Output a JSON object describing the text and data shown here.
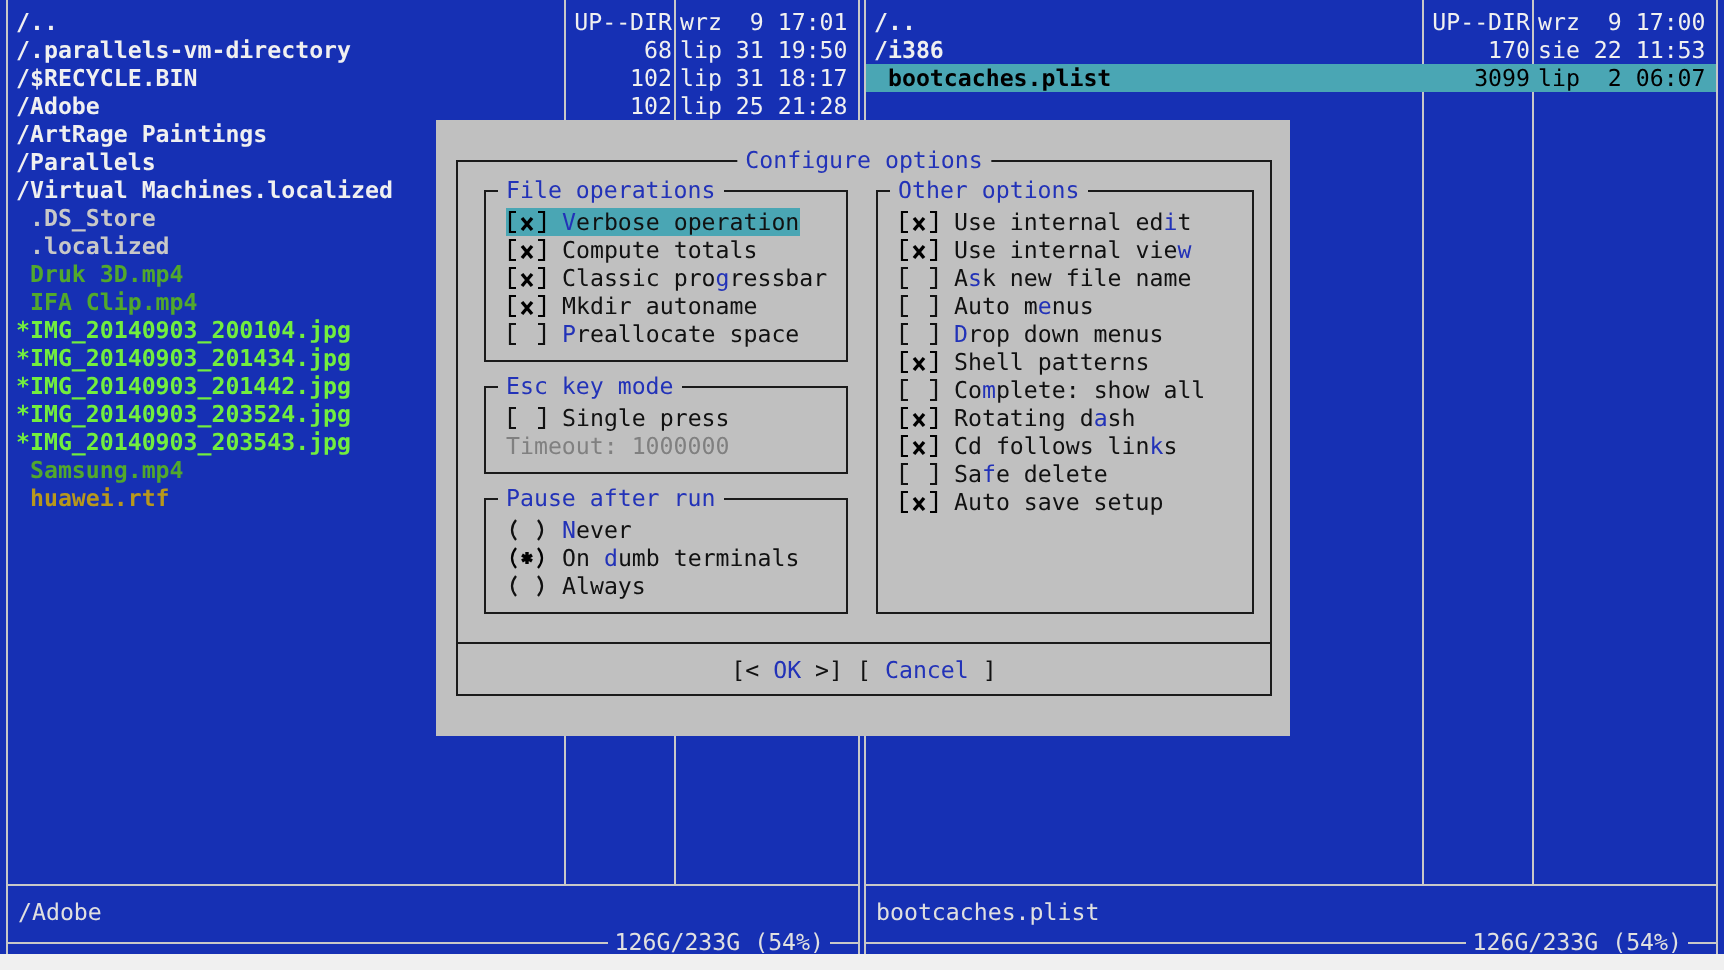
{
  "panels": [
    {
      "rows": [
        {
          "name": "/..",
          "size": "UP--DIR",
          "time": "wrz  9 17:01",
          "color": "#f0f0f0",
          "selected": false
        },
        {
          "name": "/.parallels-vm-directory",
          "size": "68",
          "time": "lip 31 19:50",
          "color": "#f0f0f0",
          "selected": false
        },
        {
          "name": "/$RECYCLE.BIN",
          "size": "102",
          "time": "lip 31 18:17",
          "color": "#f0f0f0",
          "selected": false
        },
        {
          "name": "/Adobe",
          "size": "102",
          "time": "lip 25 21:28",
          "color": "#f0f0f0",
          "selected": false
        },
        {
          "name": "/ArtRage Paintings",
          "color": "#f0f0f0",
          "selected": false
        },
        {
          "name": "/Parallels",
          "color": "#f0f0f0",
          "selected": false
        },
        {
          "name": "/Virtual Machines.localized",
          "color": "#f0f0f0",
          "selected": false
        },
        {
          "name": " .DS_Store",
          "color": "#c8c8c8",
          "selected": false
        },
        {
          "name": " .localized",
          "color": "#c8c8c8",
          "selected": false
        },
        {
          "name": " Druk 3D.mp4",
          "color": "#52a82c",
          "selected": false
        },
        {
          "name": " IFA Clip.mp4",
          "color": "#52a82c",
          "selected": false
        },
        {
          "name": "*IMG_20140903_200104.jpg",
          "color": "#72ee3e",
          "selected": false
        },
        {
          "name": "*IMG_20140903_201434.jpg",
          "color": "#72ee3e",
          "selected": false
        },
        {
          "name": "*IMG_20140903_201442.jpg",
          "color": "#72ee3e",
          "selected": false
        },
        {
          "name": "*IMG_20140903_203524.jpg",
          "color": "#72ee3e",
          "selected": false
        },
        {
          "name": "*IMG_20140903_203543.jpg",
          "color": "#72ee3e",
          "selected": false
        },
        {
          "name": " Samsung.mp4",
          "color": "#52a82c",
          "selected": false
        },
        {
          "name": " huawei.rtf",
          "color": "#b8981c",
          "selected": false
        }
      ],
      "status": "/Adobe",
      "free": "126G/233G (54%)"
    },
    {
      "rows": [
        {
          "name": "/..",
          "size": "UP--DIR",
          "time": "wrz  9 17:00",
          "color": "#f0f0f0",
          "selected": false
        },
        {
          "name": "/i386",
          "size": "170",
          "time": "sie 22 11:53",
          "color": "#f0f0f0",
          "selected": false
        },
        {
          "name": " bootcaches.plist",
          "size": "3099",
          "time": "lip  2 06:07",
          "selected": true
        }
      ],
      "status": "bootcaches.plist",
      "free": "126G/233G (54%)"
    }
  ],
  "dialog": {
    "title": "Configure options",
    "columns": [
      [
        {
          "title": "File operations",
          "options": [
            {
              "kind": "checkbox",
              "checked": true,
              "focused": true,
              "label": [
                {
                  "text": "V",
                  "hotkey": true
                },
                {
                  "text": "erbose operation",
                  "hotkey": false
                }
              ]
            },
            {
              "kind": "checkbox",
              "checked": true,
              "focused": false,
              "label": [
                {
                  "text": "Compute totals",
                  "hotkey": false
                }
              ]
            },
            {
              "kind": "checkbox",
              "checked": true,
              "focused": false,
              "label": [
                {
                  "text": "Classic pro",
                  "hotkey": false
                },
                {
                  "text": "g",
                  "hotkey": true
                },
                {
                  "text": "ressbar",
                  "hotkey": false
                }
              ]
            },
            {
              "kind": "checkbox",
              "checked": true,
              "focused": false,
              "label": [
                {
                  "text": "Mkdir autoname",
                  "hotkey": false
                }
              ]
            },
            {
              "kind": "checkbox",
              "checked": false,
              "focused": false,
              "label": [
                {
                  "text": "P",
                  "hotkey": true
                },
                {
                  "text": "reallocate space",
                  "hotkey": false
                }
              ]
            }
          ]
        },
        {
          "title": "Esc key mode",
          "options": [
            {
              "kind": "checkbox",
              "checked": false,
              "focused": false,
              "label": [
                {
                  "text": "Single press",
                  "hotkey": false
                }
              ]
            },
            {
              "kind": "field",
              "disabled": true,
              "label": [
                {
                  "text": "Timeout: 1000000",
                  "hotkey": false
                }
              ]
            }
          ]
        },
        {
          "title": "Pause after run",
          "options": [
            {
              "kind": "radio",
              "selected": false,
              "focused": false,
              "label": [
                {
                  "text": "N",
                  "hotkey": true
                },
                {
                  "text": "ever",
                  "hotkey": false
                }
              ]
            },
            {
              "kind": "radio",
              "selected": true,
              "focused": false,
              "label": [
                {
                  "text": "On ",
                  "hotkey": false
                },
                {
                  "text": "d",
                  "hotkey": true
                },
                {
                  "text": "umb terminals",
                  "hotkey": false
                }
              ]
            },
            {
              "kind": "radio",
              "selected": false,
              "focused": false,
              "label": [
                {
                  "text": "Always",
                  "hotkey": false
                }
              ]
            }
          ]
        }
      ],
      [
        {
          "title": "Other options",
          "options": [
            {
              "kind": "checkbox",
              "checked": true,
              "focused": false,
              "label": [
                {
                  "text": "Use internal ed",
                  "hotkey": false
                },
                {
                  "text": "i",
                  "hotkey": true
                },
                {
                  "text": "t",
                  "hotkey": false
                }
              ]
            },
            {
              "kind": "checkbox",
              "checked": true,
              "focused": false,
              "label": [
                {
                  "text": "Use internal vie",
                  "hotkey": false
                },
                {
                  "text": "w",
                  "hotkey": true
                }
              ]
            },
            {
              "kind": "checkbox",
              "checked": false,
              "focused": false,
              "label": [
                {
                  "text": "A",
                  "hotkey": false
                },
                {
                  "text": "s",
                  "hotkey": true
                },
                {
                  "text": "k new file name",
                  "hotkey": false
                }
              ]
            },
            {
              "kind": "checkbox",
              "checked": false,
              "focused": false,
              "label": [
                {
                  "text": "Auto m",
                  "hotkey": false
                },
                {
                  "text": "e",
                  "hotkey": true
                },
                {
                  "text": "nus",
                  "hotkey": false
                }
              ]
            },
            {
              "kind": "checkbox",
              "checked": false,
              "focused": false,
              "label": [
                {
                  "text": "D",
                  "hotkey": true
                },
                {
                  "text": "rop down menus",
                  "hotkey": false
                }
              ]
            },
            {
              "kind": "checkbox",
              "checked": true,
              "focused": false,
              "label": [
                {
                  "text": "Shell patterns",
                  "hotkey": false
                }
              ]
            },
            {
              "kind": "checkbox",
              "checked": false,
              "focused": false,
              "label": [
                {
                  "text": "Co",
                  "hotkey": false
                },
                {
                  "text": "m",
                  "hotkey": true
                },
                {
                  "text": "plete: show all",
                  "hotkey": false
                }
              ]
            },
            {
              "kind": "checkbox",
              "checked": true,
              "focused": false,
              "label": [
                {
                  "text": "Rotating d",
                  "hotkey": false
                },
                {
                  "text": "a",
                  "hotkey": true
                },
                {
                  "text": "sh",
                  "hotkey": false
                }
              ]
            },
            {
              "kind": "checkbox",
              "checked": true,
              "focused": false,
              "label": [
                {
                  "text": "Cd follows lin",
                  "hotkey": false
                },
                {
                  "text": "k",
                  "hotkey": true
                },
                {
                  "text": "s",
                  "hotkey": false
                }
              ]
            },
            {
              "kind": "checkbox",
              "checked": false,
              "focused": false,
              "label": [
                {
                  "text": "Sa",
                  "hotkey": false
                },
                {
                  "text": "f",
                  "hotkey": true
                },
                {
                  "text": "e delete",
                  "hotkey": false
                }
              ]
            },
            {
              "kind": "checkbox",
              "checked": true,
              "focused": false,
              "label": [
                {
                  "text": "Auto save setup",
                  "hotkey": false
                }
              ]
            }
          ]
        }
      ]
    ],
    "buttons": [
      {
        "label": [
          {
            "text": "[< ",
            "hotkey": false
          },
          {
            "text": "OK",
            "hotkey": true
          },
          {
            "text": " >]",
            "hotkey": false
          }
        ]
      },
      {
        "label": [
          {
            "text": "[ ",
            "hotkey": false
          },
          {
            "text": "Cancel",
            "hotkey": true
          },
          {
            "text": " ]",
            "hotkey": false
          }
        ]
      }
    ]
  }
}
